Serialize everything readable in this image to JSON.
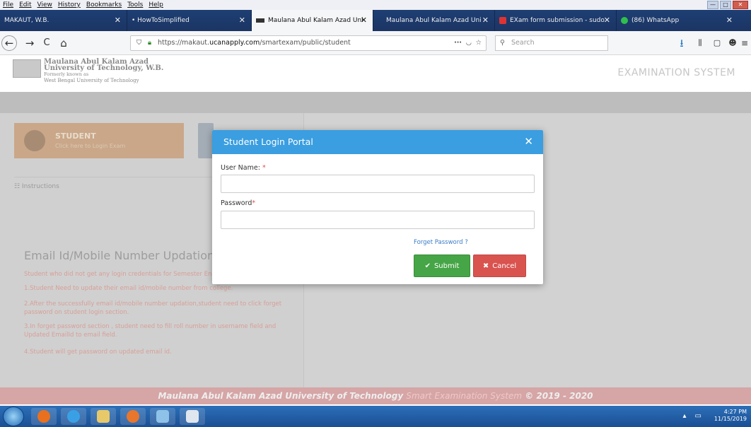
{
  "menubar": [
    "File",
    "Edit",
    "View",
    "History",
    "Bookmarks",
    "Tools",
    "Help"
  ],
  "window_controls": {
    "minimize": "—",
    "maximize": "□",
    "close": "✕"
  },
  "tabs": [
    {
      "label": "MAKAUT, W.B.",
      "icon": "",
      "active": false
    },
    {
      "label": "• HowToSimplified",
      "icon": "",
      "active": false
    },
    {
      "label": "Maulana Abul Kalam Azad Uni",
      "icon": "graduation-cap-icon",
      "active": true
    },
    {
      "label": "Maulana Abul Kalam Azad Uni",
      "icon": "",
      "active": false
    },
    {
      "label": "EXam form submission - sudo",
      "icon": "mail-icon",
      "active": false
    },
    {
      "label": "(86) WhatsApp",
      "icon": "whatsapp-icon",
      "active": false
    }
  ],
  "nav": {
    "url_prefix": "https://makaut.",
    "url_domain": "ucanapply.com",
    "url_path": "/smartexam/public/student",
    "search_placeholder": "Search",
    "glyphs": {
      "back": "←",
      "forward": "→",
      "reload": "C",
      "home": "⌂",
      "more": "···",
      "bookmark": "☆"
    }
  },
  "header": {
    "uni_line1": "Maulana Abul Kalam Azad",
    "uni_line2": "University of Technology, W.B.",
    "uni_line3": "Formerly known as",
    "uni_line4": "West Bengal University of Technology",
    "exam_system": "EXAMINATION SYSTEM"
  },
  "student_card": {
    "title": "STUDENT",
    "subtitle": "Click here to Login Exam"
  },
  "instructions": "☷ Instructions",
  "email_section": {
    "heading": "Email Id/Mobile Number Updation",
    "lines": [
      "Student who did not get any login credentials for Semester Enrollment:",
      "1.Student Need to update their email id/mobile number from college.",
      "2.After the successfully email id/mobile number updation,student need to click forget",
      "password on student login section.",
      "3.In forget password section , student need to fill roll number in username field and",
      "Updated EmailId to email field.",
      "4.Student will get password on updated email id."
    ]
  },
  "footer": {
    "university": "Maulana Abul Kalam Azad University of Technology",
    "system": "Smart Examination System",
    "copyright": "© 2019 - 2020"
  },
  "modal": {
    "title": "Student Login Portal",
    "close_glyph": "✕",
    "username_label": "User Name:",
    "username_required": "*",
    "username_value": "",
    "password_label": "Password",
    "password_required": "*",
    "password_value": "",
    "forgot_password": "Forget Password ?",
    "submit_label": "Submit",
    "cancel_label": "Cancel"
  },
  "taskbar": {
    "time": "4:27 PM",
    "date": "11/15/2019"
  },
  "colors": {
    "modal_header": "#3a9ee0",
    "submit": "#46a546",
    "cancel": "#d9534f",
    "tabstrip": "#1e3e73",
    "footer": "#d6a5a6"
  }
}
